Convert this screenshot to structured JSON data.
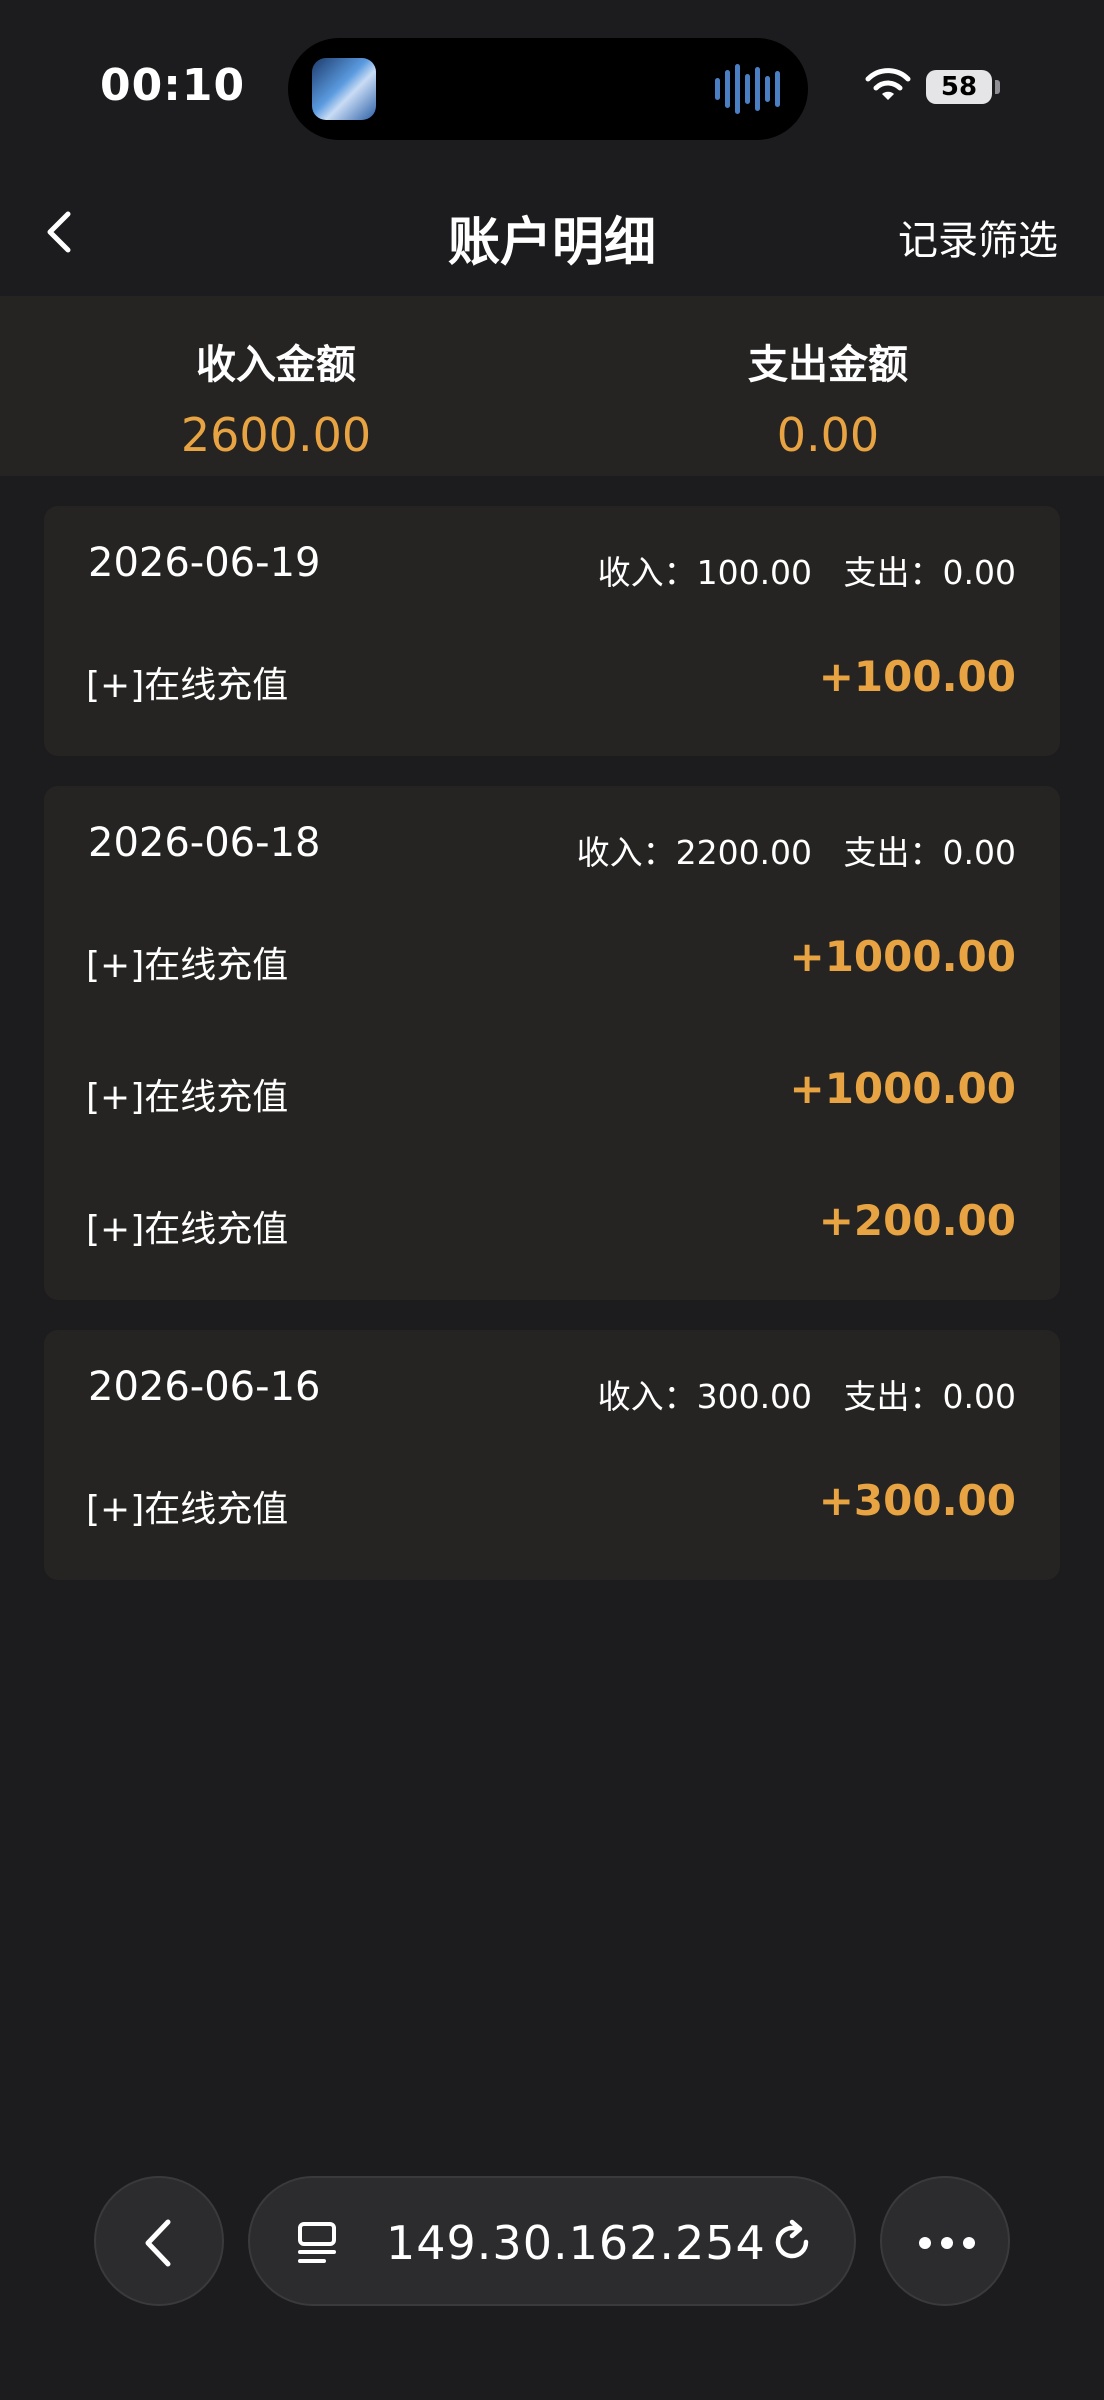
{
  "status_bar": {
    "time": "00:10",
    "battery": "58"
  },
  "nav": {
    "title": "账户明细",
    "filter_label": "记录筛选"
  },
  "summary": {
    "income_label": "收入金额",
    "income_value": "2600.00",
    "expense_label": "支出金额",
    "expense_value": "0.00"
  },
  "groups": [
    {
      "date": "2026-06-19",
      "totals": "收入：100.00   支出：0.00",
      "items": [
        {
          "label": "[+]在线充值",
          "amount": "+100.00"
        }
      ]
    },
    {
      "date": "2026-06-18",
      "totals": "收入：2200.00   支出：0.00",
      "items": [
        {
          "label": "[+]在线充值",
          "amount": "+1000.00"
        },
        {
          "label": "[+]在线充值",
          "amount": "+1000.00"
        },
        {
          "label": "[+]在线充值",
          "amount": "+200.00"
        }
      ]
    },
    {
      "date": "2026-06-16",
      "totals": "收入：300.00   支出：0.00",
      "items": [
        {
          "label": "[+]在线充值",
          "amount": "+300.00"
        }
      ]
    }
  ],
  "browser": {
    "url": "149.30.162.254"
  },
  "colors": {
    "accent": "#e8a443",
    "background": "#1c1c1e",
    "card": "#262422"
  }
}
